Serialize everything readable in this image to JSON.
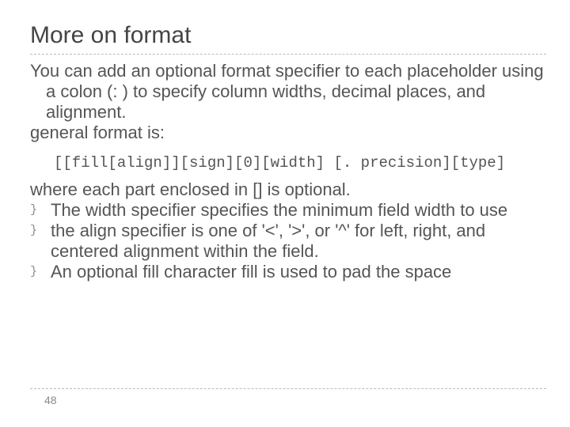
{
  "title": "More on format",
  "intro": "You can add an optional format specifier to each placeholder using a colon (: ) to specify column widths, decimal places, and alignment.",
  "general_label": "general format is:",
  "format_syntax": "[[fill[align]][sign][0][width] [. precision][type]",
  "where_line": "where each part enclosed in [] is optional.",
  "bullets": [
    "The width specifier specifies the minimum field width to use",
    "the align specifier is one of '<', '>', or '^' for left, right, and centered alignment within the field.",
    " An optional fill character fill is used to pad the space"
  ],
  "bullet_marker": "}",
  "page_number": "48"
}
